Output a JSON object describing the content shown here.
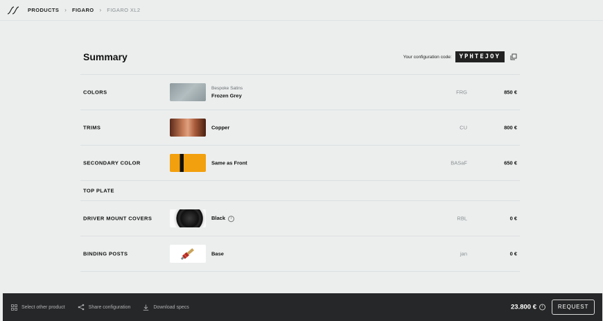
{
  "breadcrumb": {
    "items": [
      "PRODUCTS",
      "FIGARO",
      "FIGARO XL2"
    ]
  },
  "summary": {
    "title": "Summary",
    "config_code_label": "Your configuration code:",
    "config_code": "YPHTEJOY"
  },
  "rows": [
    {
      "label": "COLORS",
      "sub": "Bespoke Satins",
      "option": "Frozen Grey",
      "code": "FRG",
      "price": "850 €",
      "swatch_color": "#9aa6aa"
    },
    {
      "label": "TRIMS",
      "sub": "",
      "option": "Copper",
      "code": "CU",
      "price": "800 €",
      "swatch_color": "#b46a4a"
    },
    {
      "label": "SECONDARY COLOR",
      "sub": "",
      "option": "Same as Front",
      "code": "BASaF",
      "price": "650 €",
      "swatch_color": "#f2a00e"
    },
    {
      "label": "TOP PLATE"
    },
    {
      "label": "DRIVER MOUNT COVERS",
      "sub": "",
      "option": "Black",
      "code": "RBL",
      "price": "0 €",
      "swatch_color": "#1e1e1e"
    },
    {
      "label": "BINDING POSTS",
      "sub": "",
      "option": "Base",
      "code": "jan",
      "price": "0 €",
      "swatch_color": "#ffffff"
    }
  ],
  "footer": {
    "select_other": "Select other product",
    "share": "Share configuration",
    "download": "Download specs",
    "total": "23.800 €",
    "request": "REQUEST"
  },
  "icons": {
    "logo": "brand-logo-icon",
    "copy": "copy-icon",
    "info": "info-icon",
    "grid": "grid-icon",
    "share": "share-icon",
    "download": "download-icon"
  }
}
